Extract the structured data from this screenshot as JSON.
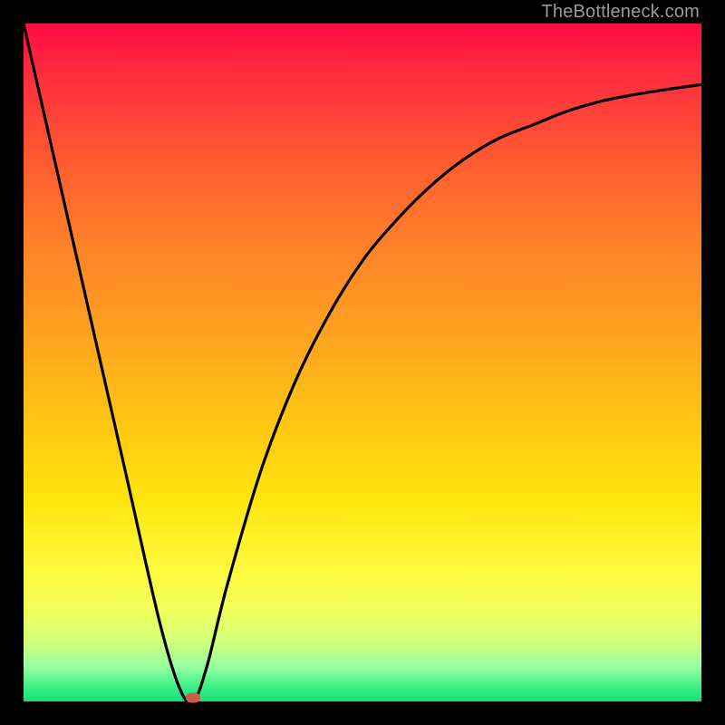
{
  "watermark": "TheBottleneck.com",
  "colors": {
    "frame": "#000000",
    "curve": "#000000",
    "min_marker": "#cd5c4a"
  },
  "chart_data": {
    "type": "line",
    "title": "",
    "xlabel": "",
    "ylabel": "",
    "xlim": [
      0,
      100
    ],
    "ylim": [
      0,
      100
    ],
    "grid": false,
    "legend": false,
    "series": [
      {
        "name": "bottleneck-curve",
        "x": [
          0,
          5,
          10,
          15,
          20,
          23,
          25,
          27,
          30,
          35,
          40,
          45,
          50,
          55,
          60,
          65,
          70,
          75,
          80,
          85,
          90,
          95,
          100
        ],
        "values": [
          100,
          78,
          56,
          34,
          12,
          2,
          0,
          5,
          17,
          34,
          47,
          57,
          65,
          71,
          76,
          80,
          83,
          85,
          87,
          88.5,
          89.5,
          90.3,
          91
        ]
      }
    ],
    "min_point": {
      "x": 25,
      "y": 0
    },
    "background_gradient": {
      "top": "#ff0b43",
      "mid": "#ffe40c",
      "bottom": "#14e27a"
    }
  }
}
